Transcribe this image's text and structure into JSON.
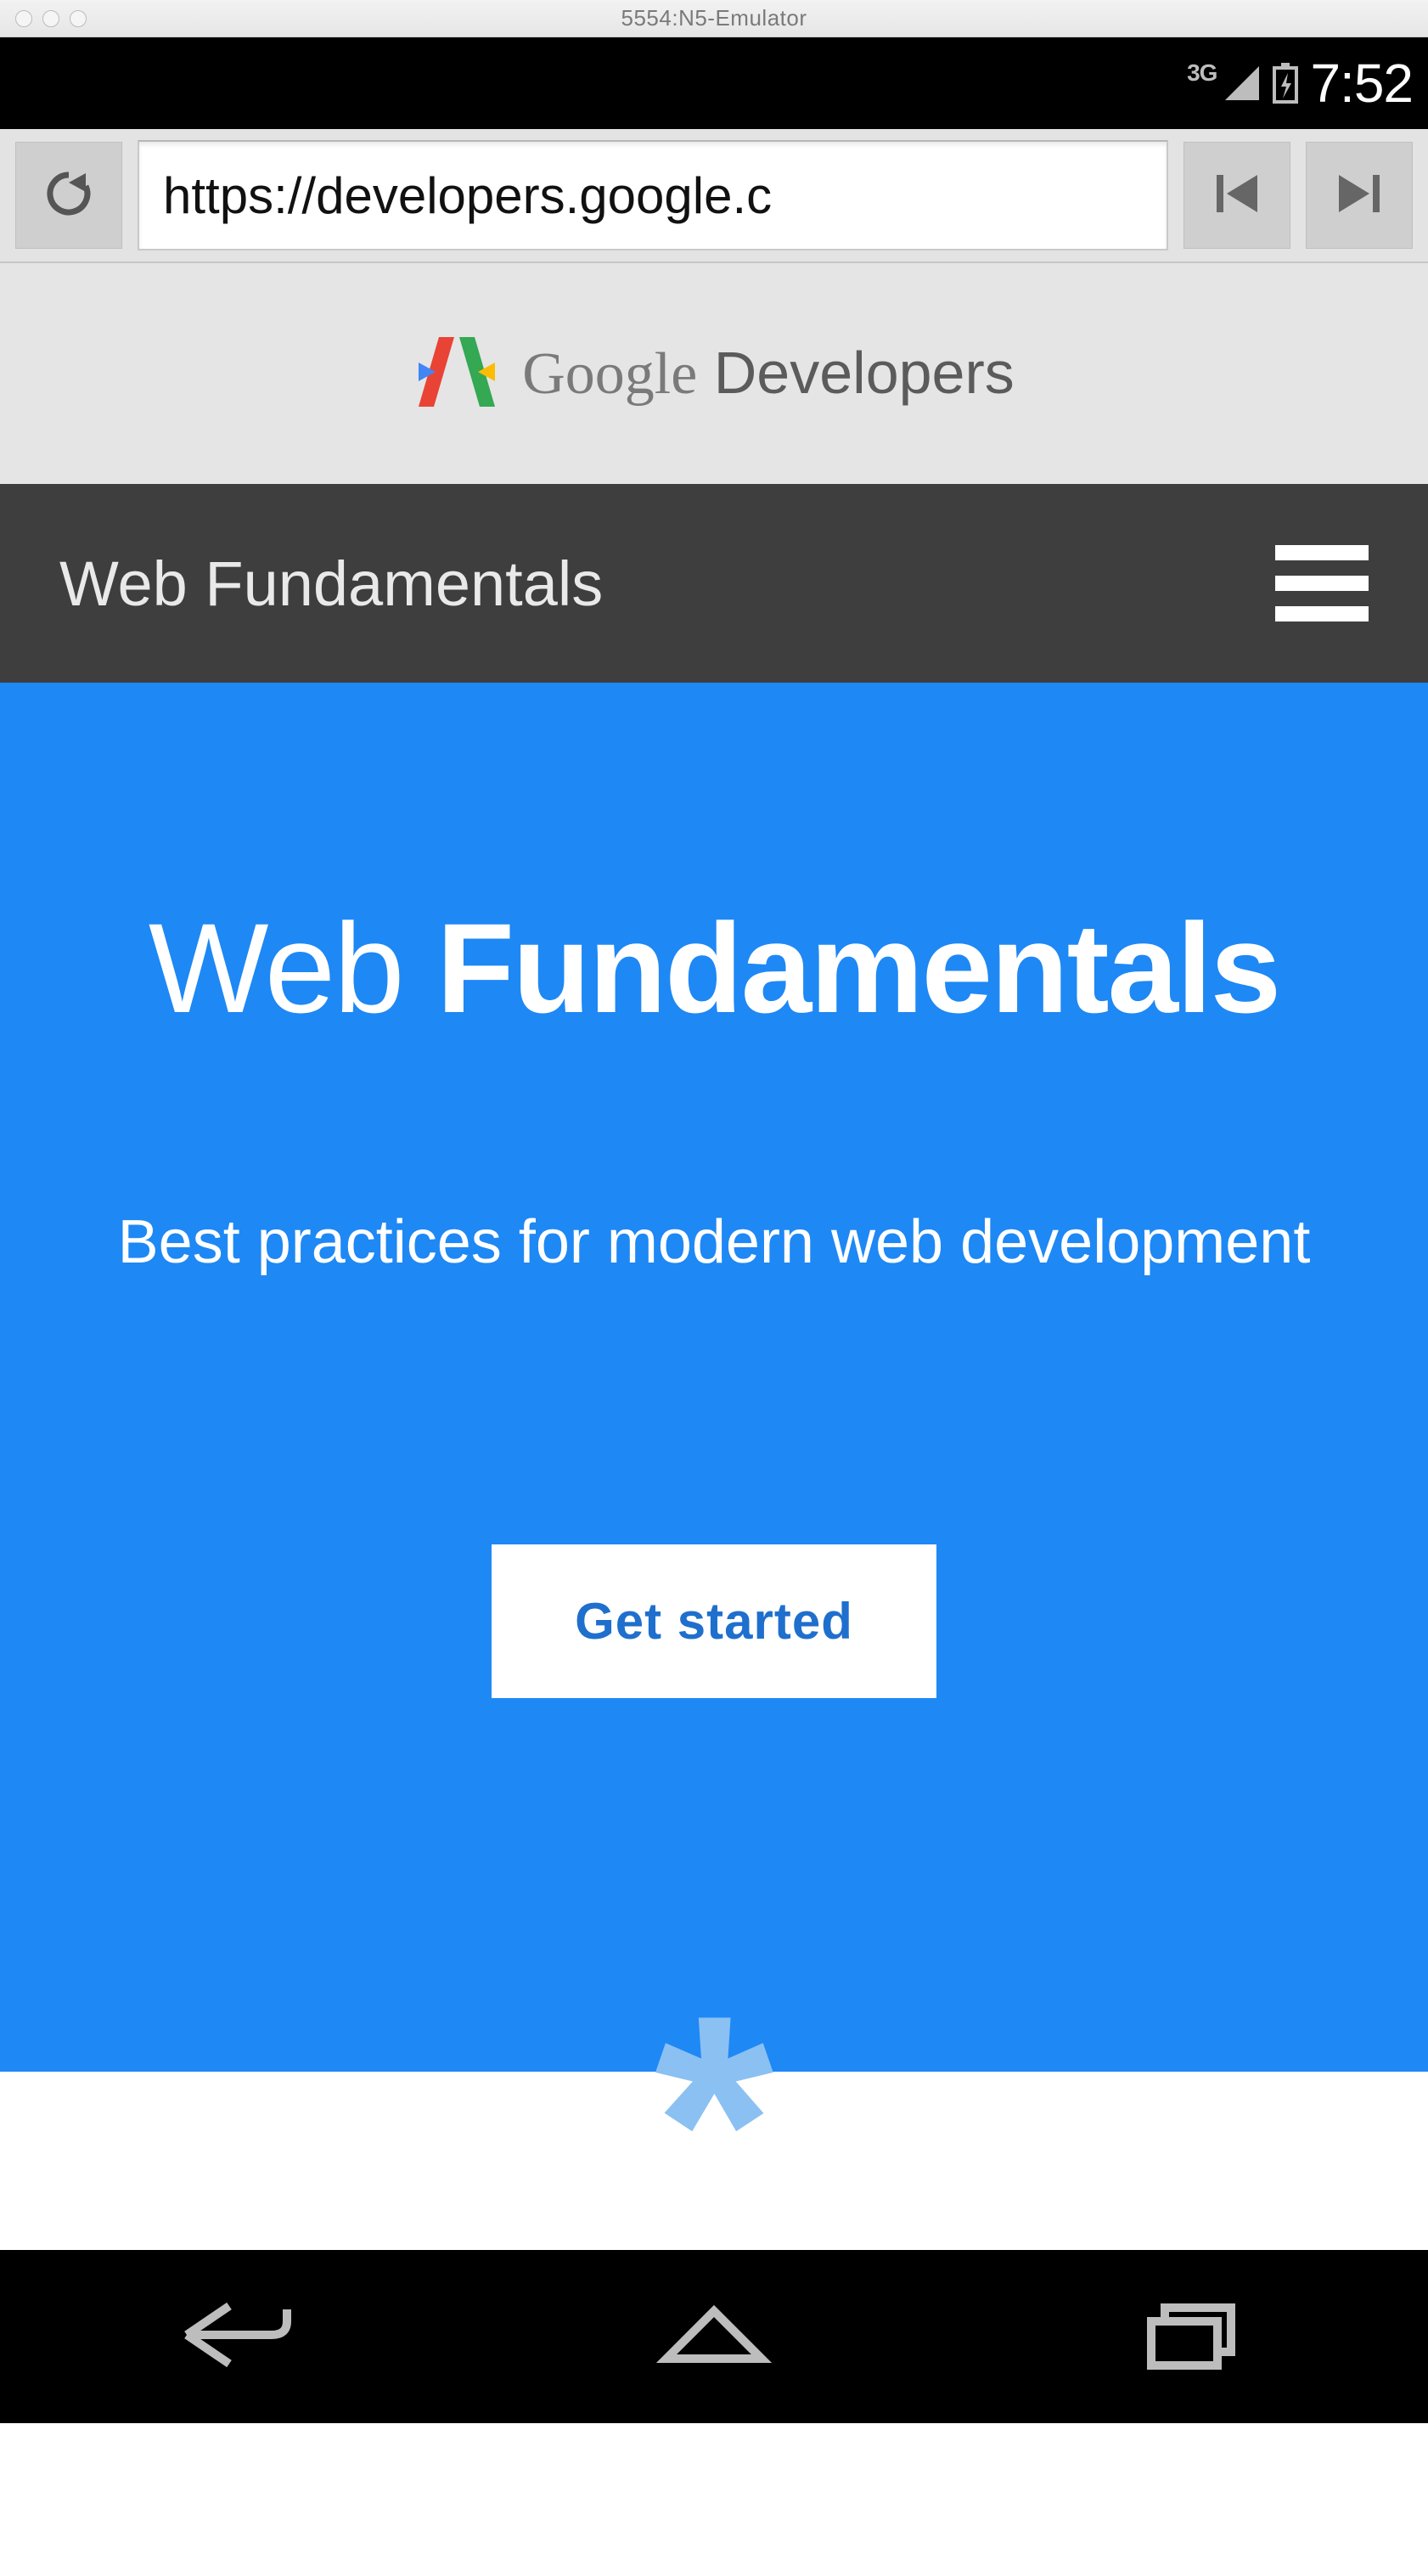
{
  "emulator": {
    "title": "5554:N5-Emulator"
  },
  "status": {
    "network_label": "3G",
    "time": "7:52"
  },
  "browser": {
    "url": "https://developers.google.c"
  },
  "header": {
    "brand_part1": "Google",
    "brand_part2": " Developers"
  },
  "section_bar": {
    "title": "Web Fundamentals"
  },
  "hero": {
    "title_light": "Web ",
    "title_bold": "Fundamentals",
    "subtitle": "Best practices for modern web development",
    "cta_label": "Get started",
    "decoration": "*"
  }
}
